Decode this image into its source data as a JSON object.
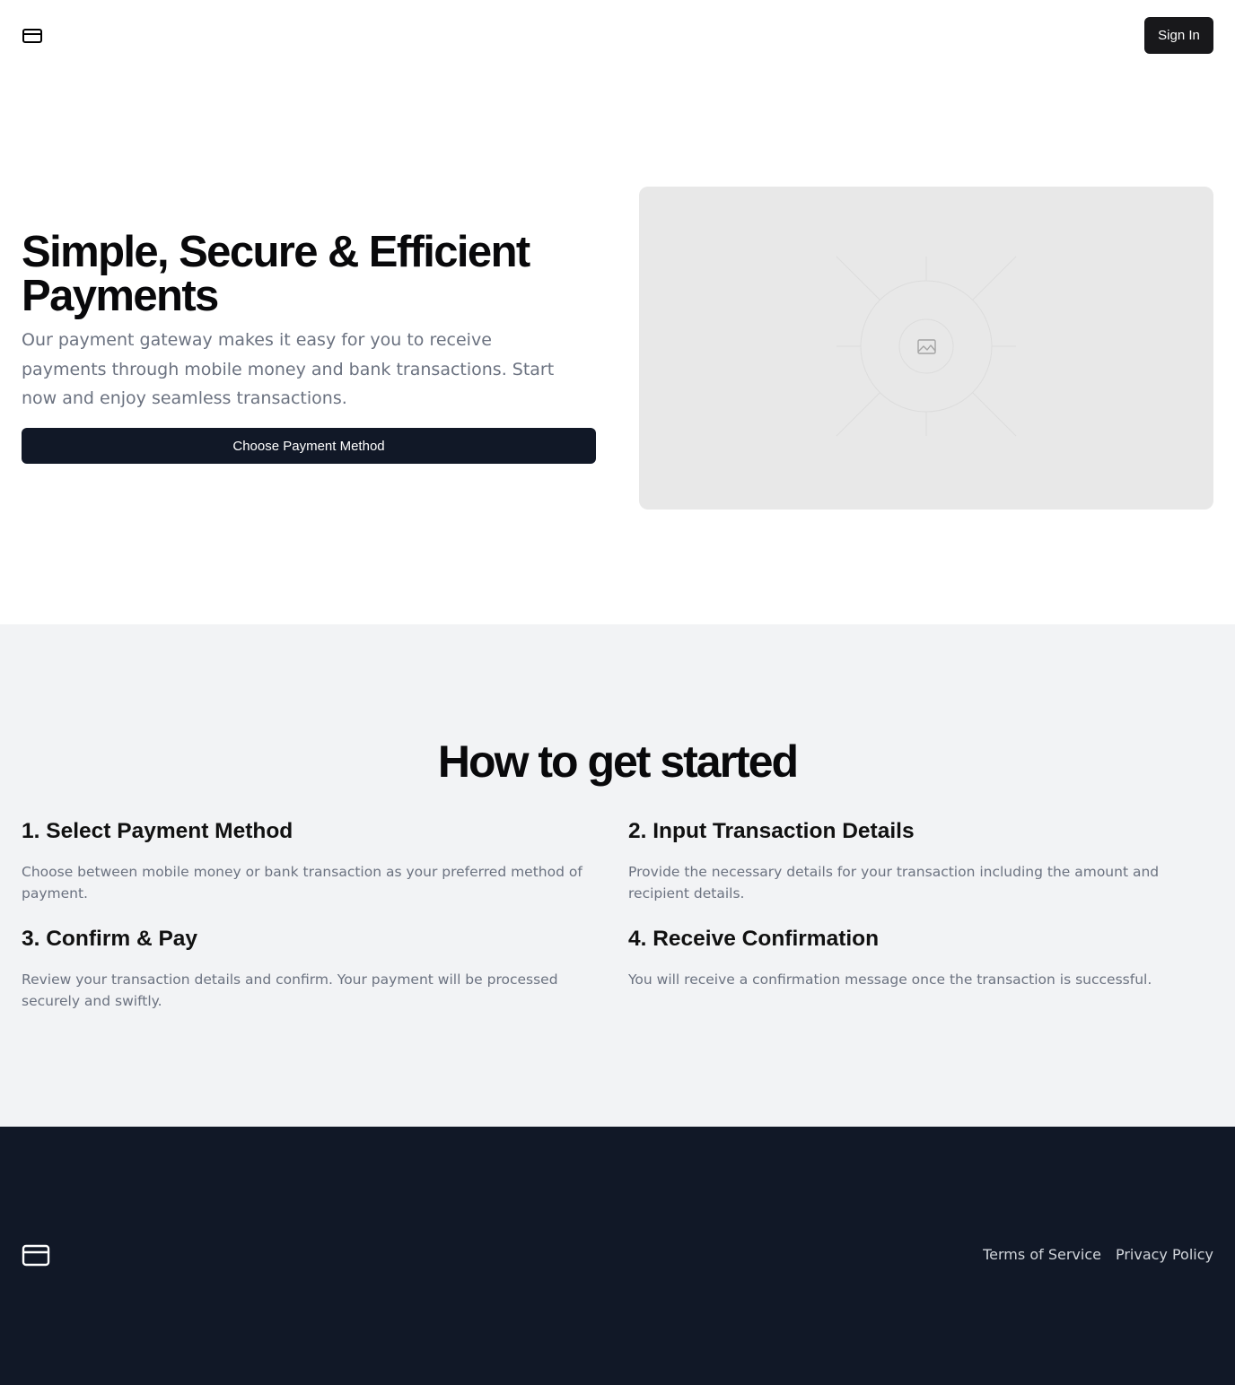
{
  "header": {
    "logo_icon": "credit-card-icon",
    "sign_in_label": "Sign In"
  },
  "hero": {
    "title": "Simple, Secure & Efficient Payments",
    "description": "Our payment gateway makes it easy for you to receive payments through mobile money and bank transactions. Start now and enjoy seamless transactions.",
    "cta_label": "Choose Payment Method",
    "image_icon": "image-placeholder-icon"
  },
  "steps": {
    "title": "How to get started",
    "items": [
      {
        "title": "1. Select Payment Method",
        "text": "Choose between mobile money or bank transaction as your preferred method of payment."
      },
      {
        "title": "2. Input Transaction Details",
        "text": "Provide the necessary details for your transaction including the amount and recipient details."
      },
      {
        "title": "3. Confirm & Pay",
        "text": "Review your transaction details and confirm. Your payment will be processed securely and swiftly."
      },
      {
        "title": "4. Receive Confirmation",
        "text": "You will receive a confirmation message once the transaction is successful."
      }
    ]
  },
  "footer": {
    "logo_icon": "credit-card-icon",
    "links": [
      "Terms of Service",
      "Privacy Policy"
    ]
  },
  "colors": {
    "primary_dark": "#111827",
    "signin_bg": "#18181b",
    "muted_text": "#6b7280",
    "section_bg": "#f2f3f5",
    "placeholder_bg": "#e8e8e8"
  }
}
